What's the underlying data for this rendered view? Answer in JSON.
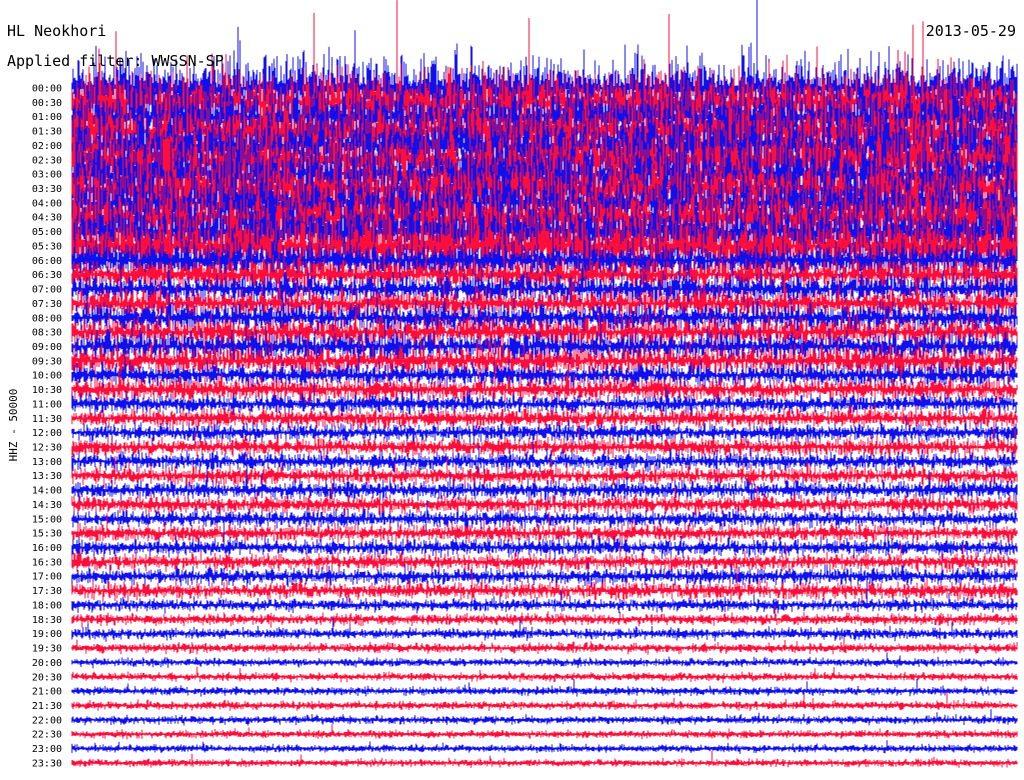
{
  "station": "HL Neokhori",
  "date": "2013-05-29",
  "filter_label": "Applied filter: WWSSN-SP",
  "channel_label": "HHZ - 50000",
  "colors": {
    "trace_a": "#1010ee",
    "trace_b": "#ff0e3c",
    "background": "#ffffff",
    "text": "#000000"
  },
  "chart_data": {
    "type": "line",
    "title": "HL Neokhori",
    "subtitle": "Applied filter: WWSSN-SP",
    "ylabel": "HHZ - 50000",
    "xlabel": "",
    "grid": false,
    "y_tick_labels": [
      "00:00",
      "00:30",
      "01:00",
      "01:30",
      "02:00",
      "02:30",
      "03:00",
      "03:30",
      "04:00",
      "04:30",
      "05:00",
      "05:30",
      "06:00",
      "06:30",
      "07:00",
      "07:30",
      "08:00",
      "08:30",
      "09:00",
      "09:30",
      "10:00",
      "10:30",
      "11:00",
      "11:30",
      "12:00",
      "12:30",
      "13:00",
      "13:30",
      "14:00",
      "14:30",
      "15:00",
      "15:30",
      "16:00",
      "16:30",
      "17:00",
      "17:30",
      "18:00",
      "18:30",
      "19:00",
      "19:30",
      "20:00",
      "20:30",
      "21:00",
      "21:30",
      "22:00",
      "22:30",
      "23:00",
      "23:30"
    ],
    "series": [
      {
        "color": "blue",
        "trace_times": [
          "00:00",
          "01:00",
          "02:00",
          "03:00",
          "04:00",
          "05:00",
          "06:00",
          "07:00",
          "08:00",
          "09:00",
          "10:00",
          "11:00",
          "12:00",
          "13:00",
          "14:00",
          "15:00",
          "16:00",
          "17:00",
          "18:00",
          "19:00",
          "20:00",
          "21:00",
          "22:00",
          "23:00"
        ]
      },
      {
        "color": "red",
        "trace_times": [
          "00:30",
          "01:30",
          "02:30",
          "03:30",
          "04:30",
          "05:30",
          "06:30",
          "07:30",
          "08:30",
          "09:30",
          "10:30",
          "11:30",
          "12:30",
          "13:30",
          "14:30",
          "15:30",
          "16:30",
          "17:30",
          "18:30",
          "19:30",
          "20:30",
          "21:30",
          "22:30",
          "23:30"
        ]
      }
    ],
    "relative_noise_amplitude": [
      9,
      9,
      8,
      9,
      10,
      9,
      10,
      9,
      9,
      9,
      9,
      9,
      5,
      4,
      4,
      4,
      4,
      4,
      4,
      4,
      3,
      3,
      2.5,
      2.5,
      2.3,
      2.3,
      2.3,
      2.3,
      2.3,
      2.3,
      2.2,
      2.2,
      2.2,
      2.2,
      2.2,
      2.2,
      1.6,
      1.4,
      1.4,
      1.2,
      1,
      1,
      1,
      1,
      1,
      0.9,
      0.9,
      0.9
    ]
  }
}
